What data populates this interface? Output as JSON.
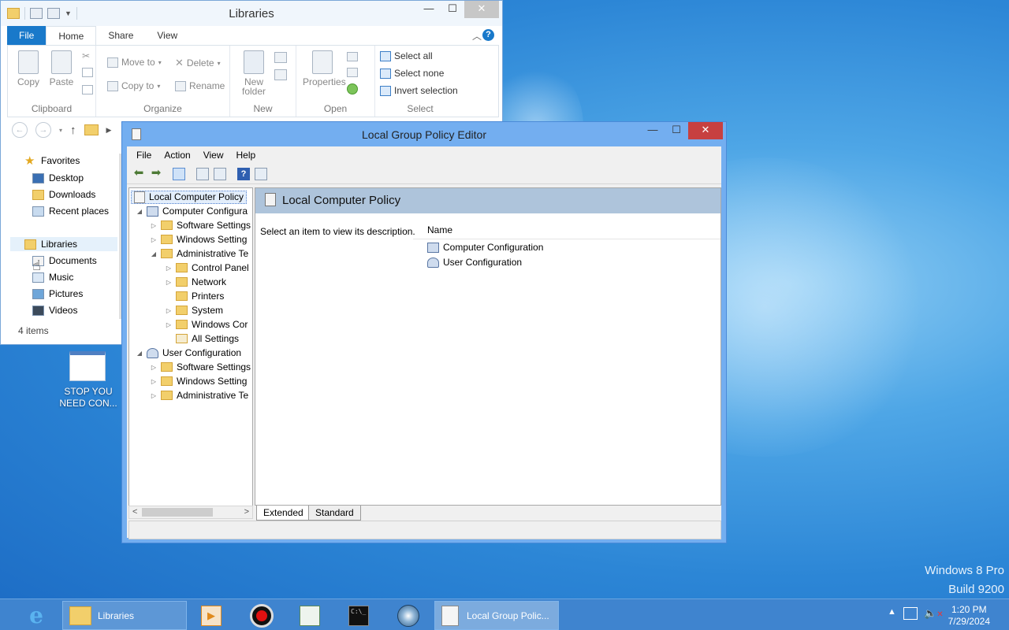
{
  "explorer": {
    "title": "Libraries",
    "tabs": [
      "File",
      "Home",
      "Share",
      "View"
    ],
    "clipboard": {
      "copy": "Copy",
      "paste": "Paste",
      "label": "Clipboard"
    },
    "organize": {
      "move_to": "Move to",
      "copy_to": "Copy to",
      "delete": "Delete",
      "rename": "Rename",
      "label": "Organize"
    },
    "new": {
      "new_folder_1": "New",
      "new_folder_2": "folder",
      "label": "New"
    },
    "open": {
      "properties": "Properties",
      "label": "Open"
    },
    "select": {
      "select_all": "Select all",
      "select_none": "Select none",
      "invert": "Invert selection",
      "label": "Select"
    },
    "nav": {
      "favorites": "Favorites",
      "desktop": "Desktop",
      "downloads": "Downloads",
      "recent": "Recent places",
      "libraries": "Libraries",
      "documents": "Documents",
      "music": "Music",
      "pictures": "Pictures",
      "videos": "Videos"
    },
    "status": "4 items"
  },
  "lgpe": {
    "title": "Local Group Policy Editor",
    "menus": [
      "File",
      "Action",
      "View",
      "Help"
    ],
    "tree": {
      "root": "Local Computer Policy",
      "computer": "Computer Configura",
      "c_software": "Software Settings",
      "c_windows": "Windows Setting",
      "c_admin": "Administrative Te",
      "control_panel": "Control Panel",
      "network": "Network",
      "printers": "Printers",
      "system": "System",
      "windows_comp": "Windows Cor",
      "all_settings": "All Settings",
      "user": "User Configuration",
      "u_software": "Software Settings",
      "u_windows": "Windows Setting",
      "u_admin": "Administrative Te"
    },
    "content": {
      "header": "Local Computer Policy",
      "description": "Select an item to view its description.",
      "column_name": "Name",
      "items": [
        "Computer Configuration",
        "User Configuration"
      ]
    },
    "tabs": {
      "extended": "Extended",
      "standard": "Standard"
    }
  },
  "desktop": {
    "icon_label_1": "STOP YOU",
    "icon_label_2": "NEED CON...",
    "watermark_1": "Windows 8 Pro",
    "watermark_2": "Build 9200"
  },
  "taskbar": {
    "libraries": "Libraries",
    "lgpe": "Local Group Polic...",
    "time": "1:20 PM",
    "date": "7/29/2024"
  },
  "colors": {
    "accent": "#1979ca",
    "taskbar": "#3f84cf",
    "lgpe_frame": "#73aef0"
  }
}
